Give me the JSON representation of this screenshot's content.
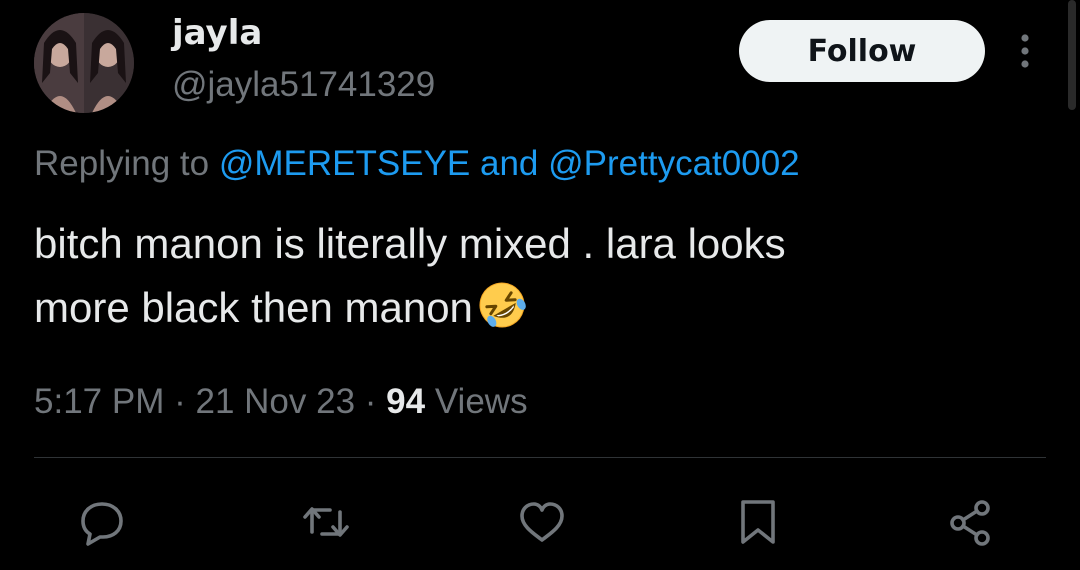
{
  "tweet": {
    "display_name": "jayla",
    "handle": "@jayla51741329",
    "follow_label": "Follow",
    "replying_prefix": "Replying to",
    "reply_mention_1": "@MERETSEYE",
    "reply_joiner": "and",
    "reply_mention_2": "@Prettycat0002",
    "text_line_1": "bitch manon is literally mixed . lara looks",
    "text_line_2": "more black then manon",
    "emoji": "rolling-on-the-floor-laughing",
    "time": "5:17 PM",
    "separator": "·",
    "date": "21 Nov 23",
    "views_count": "94",
    "views_label": "Views"
  },
  "icons": {
    "more": "more-vertical-icon",
    "reply": "reply-icon",
    "retweet": "retweet-icon",
    "like": "like-icon",
    "bookmark": "bookmark-icon",
    "share": "share-icon"
  },
  "colors": {
    "background": "#000000",
    "primary_text": "#e7e9ea",
    "secondary_text": "#71767b",
    "accent": "#1d9bf0",
    "divider": "#2f3336",
    "follow_bg": "#eff3f4",
    "follow_text": "#0f1419"
  }
}
